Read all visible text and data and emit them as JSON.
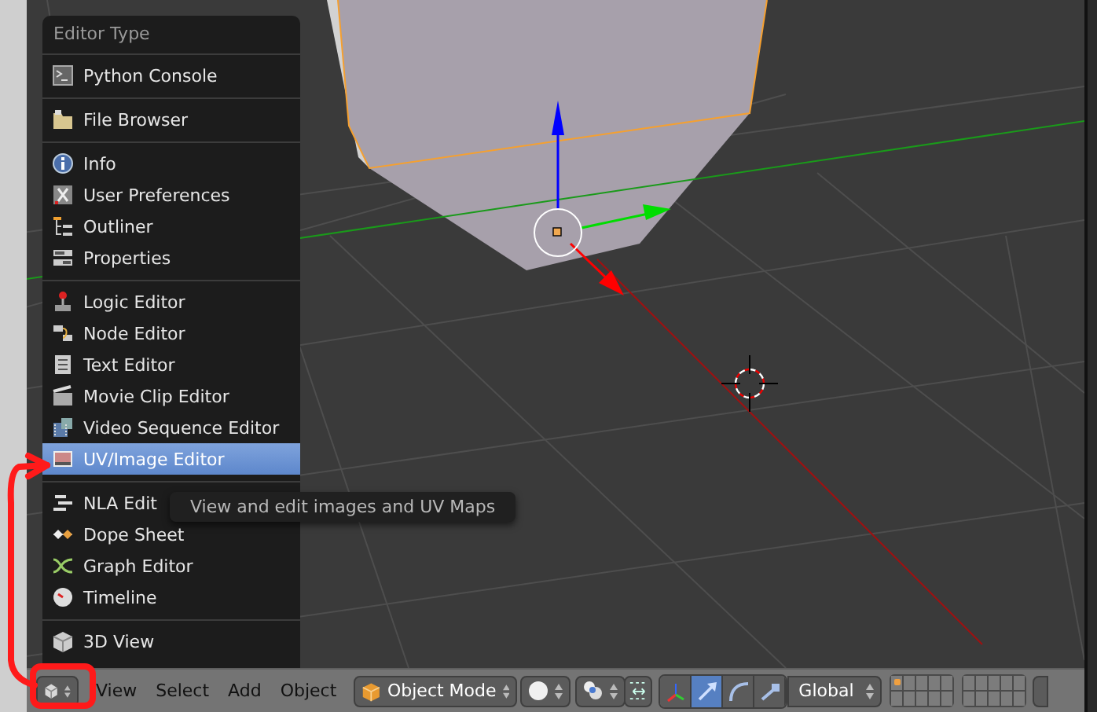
{
  "menu": {
    "title": "Editor Type",
    "sections": [
      {
        "items": [
          {
            "label": "Python Console",
            "selected": false
          }
        ]
      },
      {
        "items": [
          {
            "label": "File Browser",
            "selected": false
          }
        ]
      },
      {
        "items": [
          {
            "label": "Info",
            "selected": false
          },
          {
            "label": "User Preferences",
            "selected": false
          },
          {
            "label": "Outliner",
            "selected": false
          },
          {
            "label": "Properties",
            "selected": false
          }
        ]
      },
      {
        "items": [
          {
            "label": "Logic Editor",
            "selected": false
          },
          {
            "label": "Node Editor",
            "selected": false
          },
          {
            "label": "Text Editor",
            "selected": false
          },
          {
            "label": "Movie Clip Editor",
            "selected": false
          },
          {
            "label": "Video Sequence Editor",
            "selected": false
          },
          {
            "label": "UV/Image Editor",
            "selected": true
          }
        ]
      },
      {
        "items": [
          {
            "label": "NLA Edit",
            "selected": false
          },
          {
            "label": "Dope Sheet",
            "selected": false
          },
          {
            "label": "Graph Editor",
            "selected": false
          },
          {
            "label": "Timeline",
            "selected": false
          }
        ]
      },
      {
        "items": [
          {
            "label": "3D View",
            "selected": false
          }
        ]
      }
    ]
  },
  "tooltip": {
    "text": "View and edit images and UV Maps"
  },
  "header": {
    "menus": [
      "View",
      "Select",
      "Add",
      "Object"
    ],
    "mode": {
      "label": "Object Mode"
    },
    "orientation": {
      "label": "Global"
    },
    "manipulators": [
      {
        "selected": false
      },
      {
        "selected": true
      },
      {
        "selected": false
      },
      {
        "selected": false
      }
    ],
    "layers": [
      {
        "has_objects": true
      },
      {
        "has_objects": false
      },
      {
        "has_objects": false
      },
      {
        "has_objects": false
      },
      {
        "has_objects": false
      },
      {
        "has_objects": false
      },
      {
        "has_objects": false
      },
      {
        "has_objects": false
      },
      {
        "has_objects": false
      },
      {
        "has_objects": false
      },
      {
        "has_objects": false
      },
      {
        "has_objects": false
      },
      {
        "has_objects": false
      },
      {
        "has_objects": false
      },
      {
        "has_objects": false
      },
      {
        "has_objects": false
      },
      {
        "has_objects": false
      },
      {
        "has_objects": false
      },
      {
        "has_objects": false
      },
      {
        "has_objects": false
      }
    ]
  }
}
